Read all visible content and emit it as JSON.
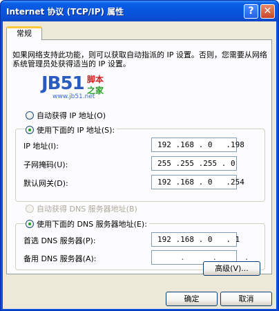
{
  "window": {
    "title": "Internet 协议 (TCP/IP) 属性",
    "help_label": "?",
    "close_label": "✕"
  },
  "tab": {
    "label": "常规"
  },
  "description": "如果网络支持此功能，则可以获取自动指派的 IP 设置。否则，您需要从网络系统管理员处获得适当的 IP 设置。",
  "watermark": {
    "logo": "JB51",
    "cn1": "脚本",
    "cn2": "之家",
    "url": "www.jb51.net"
  },
  "ip": {
    "auto_label": "自动获得 IP 地址(O)",
    "manual_label": "使用下面的 IP 地址(S):",
    "fields": [
      {
        "label": "IP 地址(I):",
        "value": "192 .168 . 0   .198"
      },
      {
        "label": "子网掩码(U):",
        "value": "255 .255 .255 . 0"
      },
      {
        "label": "默认网关(D):",
        "value": "192 .168 . 0   .254"
      }
    ]
  },
  "dns": {
    "auto_label": "自动获得 DNS 服务器地址(B)",
    "manual_label": "使用下面的 DNS 服务器地址(E):",
    "fields": [
      {
        "label": "首选 DNS 服务器(P):",
        "value": "192 .168 . 0   . 1"
      },
      {
        "label": "备用 DNS 服务器(A):",
        "value": "     .      .      ."
      }
    ]
  },
  "buttons": {
    "advanced": "高级(V)...",
    "ok": "确定",
    "cancel": "取消"
  }
}
